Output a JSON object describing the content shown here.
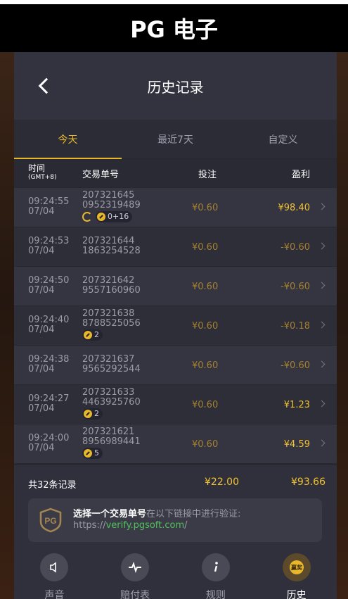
{
  "top_title": "PG 电子",
  "page_title": "历史记录",
  "tabs": [
    "今天",
    "最近7天",
    "自定义"
  ],
  "columns": {
    "time": "时间",
    "tz": "(GMT+8)",
    "order": "交易单号",
    "bet": "投注",
    "win": "盈利"
  },
  "rows": [
    {
      "time": "09:24:55",
      "date": "07/04",
      "order1": "207321645",
      "order2": "0952319489",
      "bet": "¥0.60",
      "win": "¥98.40",
      "badge": "0+16"
    },
    {
      "time": "09:24:53",
      "date": "07/04",
      "order1": "207321644",
      "order2": "1863254528",
      "bet": "¥0.60",
      "win": "-¥0.60"
    },
    {
      "time": "09:24:50",
      "date": "07/04",
      "order1": "207321642",
      "order2": "9557160960",
      "bet": "¥0.60",
      "win": "-¥0.60"
    },
    {
      "time": "09:24:40",
      "date": "07/04",
      "order1": "207321638",
      "order2": "8788525056",
      "bet": "¥0.60",
      "win": "-¥0.18",
      "badge": "2"
    },
    {
      "time": "09:24:38",
      "date": "07/04",
      "order1": "207321637",
      "order2": "9565292544",
      "bet": "¥0.60",
      "win": "-¥0.60"
    },
    {
      "time": "09:24:27",
      "date": "07/04",
      "order1": "207321633",
      "order2": "4463925760",
      "bet": "¥0.60",
      "win": "¥1.23",
      "badge": "2"
    },
    {
      "time": "09:24:00",
      "date": "07/04",
      "order1": "207321621",
      "order2": "8956989441",
      "bet": "¥0.60",
      "win": "¥4.59",
      "badge": "5"
    }
  ],
  "total": {
    "count": "共32条记录",
    "bet": "¥22.00",
    "win": "¥93.66"
  },
  "verify": {
    "bold": "选择一个交易单号",
    "rest": "在以下链接中进行验证:",
    "prefix": "https://",
    "link": "verify.pgsoft.com",
    "suffix": "/"
  },
  "logo_text": "PG",
  "nav": [
    "声音",
    "赔付表",
    "规则",
    "历史"
  ],
  "history_icon_text": "赢奖"
}
